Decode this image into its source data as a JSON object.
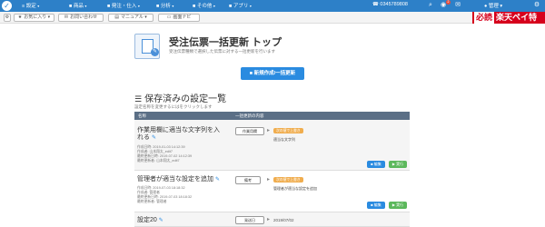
{
  "topbar": {
    "menus": [
      {
        "label": "設定",
        "left": 0
      },
      {
        "label": "商品",
        "left": 0
      },
      {
        "label": "発注・仕入",
        "left": 0
      },
      {
        "label": "分析",
        "left": 0
      },
      {
        "label": "その他",
        "left": 0
      },
      {
        "label": "アプリ",
        "left": 0
      }
    ],
    "phone": "0345789808",
    "user": "管理"
  },
  "subbar": {
    "fav": "お気に入り",
    "contact": "お問い合わせ",
    "manual": "マニュアル",
    "navi": "画面ナビ"
  },
  "banner": {
    "must": "必読",
    "text": "楽天ペイ特集"
  },
  "header": {
    "title": "受注伝票一括更新 トップ",
    "description": "受注伝票種類で選択した伝票に対する一括更新を行います"
  },
  "new_button": "新規作成/一括更新",
  "section": {
    "title": "保存済みの設定一覧",
    "subtitle": "設定名称を変更するにはをクリックします"
  },
  "table": {
    "headers": [
      "名称",
      "一括更新の内容"
    ],
    "rows": [
      {
        "name_line1": "作業用欄に適当な文字列を入",
        "name_line2": "れる",
        "meta": [
          "作成日時: 2019-01-03 14:12:39",
          "作成者: 山本翔太_edit7",
          "最終更新日時: 2019-07-02 14:12:39",
          "最終更新者: 山本翔太_edit7"
        ],
        "field": "作業用欄",
        "action": "次の値で上書き",
        "value": "適当な文字列",
        "edit": "編集",
        "run": "実行"
      },
      {
        "name_line1": "管理者が適当な設定を追加",
        "meta": [
          "作成日時: 2019-07-03 18:18:32",
          "作成者: 管理者",
          "最終更新日時: 2019-07-03 18:18:32",
          "最終更新者: 管理者"
        ],
        "field": "備考",
        "action": "次の値で上書き",
        "value": "管理者が適当な設定を追加",
        "edit": "編集",
        "run": "実行"
      },
      {
        "name_line1": "設定20",
        "field": "発送日",
        "date": "2019/07/02"
      }
    ]
  },
  "colors": {
    "primary": "#2d80c8",
    "button_blue": "#2a8be0",
    "orange": "#f0ad4e",
    "green": "#5cb85c",
    "banner_red": "#d6001c",
    "table_header": "#5b6f86"
  },
  "icons": [
    "logo-icon",
    "search-icon",
    "bell-icon",
    "mail-icon",
    "settings-icon",
    "list-icon",
    "pencil-icon",
    "arrow-right-icon"
  ]
}
